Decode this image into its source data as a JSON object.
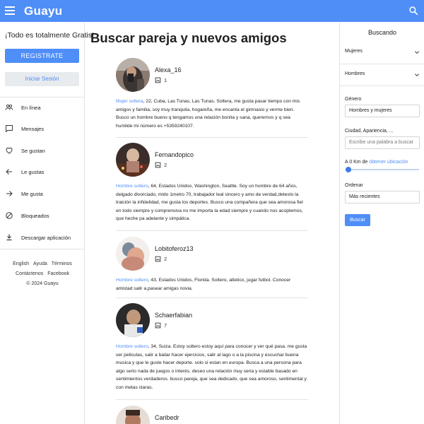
{
  "app": {
    "brand": "Guayu"
  },
  "colors": {
    "primary": "#4f8ef7",
    "header": "#4f8ef7"
  },
  "left_sidebar": {
    "promo_text": "¡Todo es totalmente Gratis!",
    "register_label": "REGISTRATE",
    "login_label": "Iniciar Sesión",
    "nav": [
      {
        "label": "En línea",
        "icon": "people-icon"
      },
      {
        "label": "Mensajes",
        "icon": "chat-icon"
      },
      {
        "label": "Se gustan",
        "icon": "heart-icon"
      },
      {
        "label": "Le gustas",
        "icon": "arrow-left-icon"
      },
      {
        "label": "Me gusta",
        "icon": "arrow-right-icon"
      },
      {
        "label": "Bloqueados",
        "icon": "block-icon"
      },
      {
        "label": "Descargar aplicación",
        "icon": "download-icon"
      }
    ],
    "footer": {
      "english": "English",
      "ayuda": "Ayuda",
      "terminos": "Términos",
      "contactenos": "Contáctenos",
      "facebook": "Facebook",
      "copyright": "© 2024  Guayu"
    }
  },
  "main": {
    "title": "Buscar pareja y nuevos amigos",
    "profiles": [
      {
        "username": "Alexa_16",
        "photos": "1",
        "kind": "Mujer soltera",
        "text": ", 22, Cuba, Las Tunas, Las Tunas. Soltera, me gusta pasar tiempo con mis amigos y familia, soy muy tranquila, hogareña, me encanta el gimnasio y verme bien. Busco un hombre bueno q tengamos una relación bonita y sana, querernos y q sea humilde mi número es +5359240107."
      },
      {
        "username": "Fernandopico",
        "photos": "2",
        "kind": "Hombre soltero",
        "text": ", 64, Estados Unidos, Washington, Seattle. Soy un hombre de 64 años, delgado divorciado, mido 1metro 70, trabajador leal sincero y amo de verdad,detesto la traición la infidelidad, me gusta los deportes. Busco una compañera que sea amorosa fiel en todo siempre y comprensiva no me importa la edad siempre y cuando nos acoplemos, que heche pa adelante y simpática."
      },
      {
        "username": "Lobitoferoz13",
        "photos": "2",
        "kind": "Hombre soltero",
        "text": ", 43, Estados Unidos, Florida. Soltero, atletico, jugar futbol. Conocer amistad salir a,pasear amigas novia."
      },
      {
        "username": "Schaerfabian",
        "photos": "7",
        "kind": "Hombre soltero",
        "text": ", 34, Suiza. Estoy soltero estoy aquí para conocer y ver qué pasa. me gusta ver peliculas, salir a bailar hacer ejercicios, salir al lago o a la piscina y escuchar buena musica y que le guste hacer deporte. solo si estan en europa. Busca a una persona para algo serio nada de juegos o interés. deseo una relación muy seria y estable basado en sentimientos verdaderos. busco pareja, que sea dedicado, que sea amoroso, sentimental y con metas claras."
      },
      {
        "username": "Caribedr",
        "photos": "",
        "kind": "",
        "text": ""
      }
    ]
  },
  "right_sidebar": {
    "title": "Buscando",
    "looking_for": "Mujeres",
    "i_am": "Hombres",
    "genero_label": "Género",
    "genero_value": "Hombres y mujeres",
    "city_label": "Ciudad, Apariencia, ...",
    "city_placeholder": "Escribe una palabra a buscar",
    "distance_text": "A 0 Km de ",
    "distance_link": "obtener ubicación",
    "distance_value_km": 0,
    "order_label": "Ordenar",
    "order_value": "Más recientes",
    "search_button": "Buscar"
  }
}
